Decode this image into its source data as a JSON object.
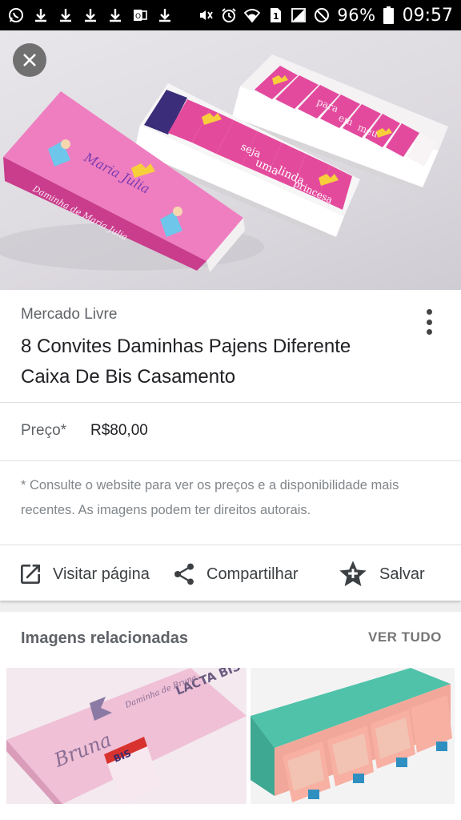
{
  "status_bar": {
    "battery_percent": "96%",
    "time": "09:57",
    "sim_slot": "1"
  },
  "viewer": {
    "close_icon": "close-icon",
    "source": "Mercado Livre",
    "title": "8 Convites Daminhas Pajens Diferente Caixa De Bis Casamento",
    "price_label": "Preço*",
    "price_value": "R$80,00",
    "disclaimer": "* Consulte o website para ver os preços e a disponibilidade mais recentes. As imagens podem ter direitos autorais.",
    "actions": [
      {
        "label": "Visitar página",
        "icon": "open-in-new-icon"
      },
      {
        "label": "Compartilhar",
        "icon": "share-icon"
      },
      {
        "label": "Salvar",
        "icon": "star-icon"
      }
    ]
  },
  "hero_image": {
    "box_text_1": "Maria Julia",
    "box_text_2": "Daminha de Maria Julia",
    "pieces": [
      "seja",
      "uma",
      "linda",
      "princesa",
      "para",
      "em",
      "meu"
    ]
  },
  "related": {
    "title": "Imagens relacionadas",
    "see_all": "VER TUDO",
    "thumb1_text": {
      "name": "Bruna",
      "brand": "LACTA BIS",
      "script": "Daminha de Bruna",
      "wrapper": "BIS"
    }
  },
  "colors": {
    "accent_pink": "#e0489a",
    "teal": "#4dbfa7",
    "salmon": "#f1a89a"
  }
}
